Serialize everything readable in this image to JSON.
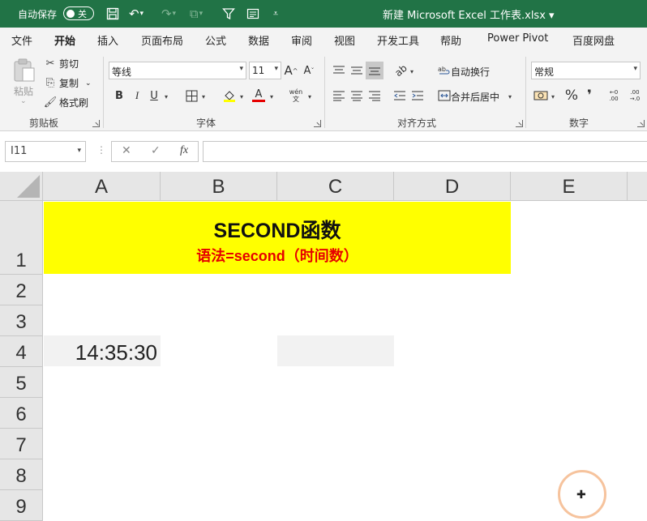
{
  "titlebar": {
    "autosave_label": "自动保存",
    "autosave_state": "关",
    "doc_title": "新建 Microsoft Excel 工作表.xlsx ▾",
    "accent": "#217346"
  },
  "tabs": [
    "文件",
    "开始",
    "插入",
    "页面布局",
    "公式",
    "数据",
    "审阅",
    "视图",
    "开发工具",
    "帮助",
    "Power Pivot",
    "百度网盘"
  ],
  "active_tab": "开始",
  "clipboard": {
    "paste": "粘贴",
    "cut": "剪切",
    "copy": "复制",
    "format_painter": "格式刷",
    "group_label": "剪贴板"
  },
  "font": {
    "name": "等线",
    "size": "11",
    "group_label": "字体",
    "bold": "B",
    "italic": "I",
    "underline": "U",
    "grow": "A",
    "shrink": "A",
    "phonetic": "wén"
  },
  "alignment": {
    "wrap_text": "自动换行",
    "merge_center": "合并后居中",
    "group_label": "对齐方式"
  },
  "number": {
    "format": "常规",
    "percent": "%",
    "comma": "❜",
    "group_label": "数字"
  },
  "formula_bar": {
    "name_box": "I11",
    "fx": "fx",
    "formula": ""
  },
  "sheet": {
    "columns": [
      "A",
      "B",
      "C",
      "D",
      "E"
    ],
    "rows": [
      "1",
      "2",
      "3",
      "4",
      "5",
      "6",
      "7",
      "8",
      "9"
    ],
    "title": "SECOND函数",
    "syntax": "语法=second（时间数）",
    "a4_value": "14:35:30",
    "highlight_color": "#ffff00",
    "syntax_color": "#e60000"
  }
}
